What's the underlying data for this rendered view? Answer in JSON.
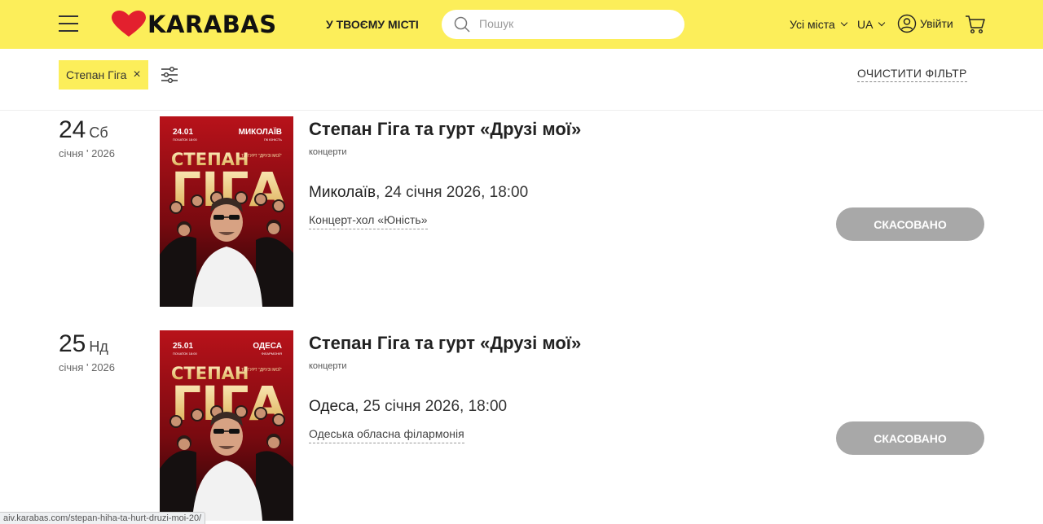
{
  "header": {
    "logo_text": "KARABAS",
    "city_link": "У ТВОЄМУ МІСТІ",
    "search_placeholder": "Пошук",
    "cities_label": "Усі міста",
    "lang_label": "UA",
    "login_label": "Увійти",
    "bg_color": "#fcee5a",
    "logo_heart_color": "#e3202e"
  },
  "filter": {
    "chip_label": "Степан Гіга",
    "chip_close": "×",
    "clear_label": "ОЧИСТИТИ ФІЛЬТР"
  },
  "events": [
    {
      "day": "24",
      "dow": "Сб",
      "month": "січня ' 2026",
      "title": "Степан Гіга та гурт «Друзі мої»",
      "category": "концерти",
      "city": "Миколаїв",
      "datetime": ", 24 січня 2026, 18:00",
      "venue": "Концерт-хол «Юність»",
      "status": "СКАСОВАНО",
      "poster": {
        "date": "24.01",
        "time": "ПОЧАТОК 18:00",
        "city": "МИКОЛАЇВ",
        "hall": "ПК ЮНІСТЬ",
        "name1": "СТЕПАН",
        "name2": "ГІГА",
        "band": "ТА ГУРТ \"ДРУЗІ МОЇ\""
      }
    },
    {
      "day": "25",
      "dow": "Нд",
      "month": "січня ' 2026",
      "title": "Степан Гіга та гурт «Друзі мої»",
      "category": "концерти",
      "city": "Одеса",
      "datetime": ", 25 січня 2026, 18:00",
      "venue": "Одеська обласна філармонія",
      "status": "СКАСОВАНО",
      "poster": {
        "date": "25.01",
        "time": "ПОЧАТОК 18:00",
        "city": "ОДЕСА",
        "hall": "ФІЛАРМОНІЯ",
        "name1": "СТЕПАН",
        "name2": "ГІГА",
        "band": "ТА ГУРТ \"ДРУЗІ МОЇ\""
      }
    }
  ],
  "status_bar": {
    "url": "aiv.karabas.com/stepan-hiha-ta-hurt-druzi-moi-20/"
  }
}
